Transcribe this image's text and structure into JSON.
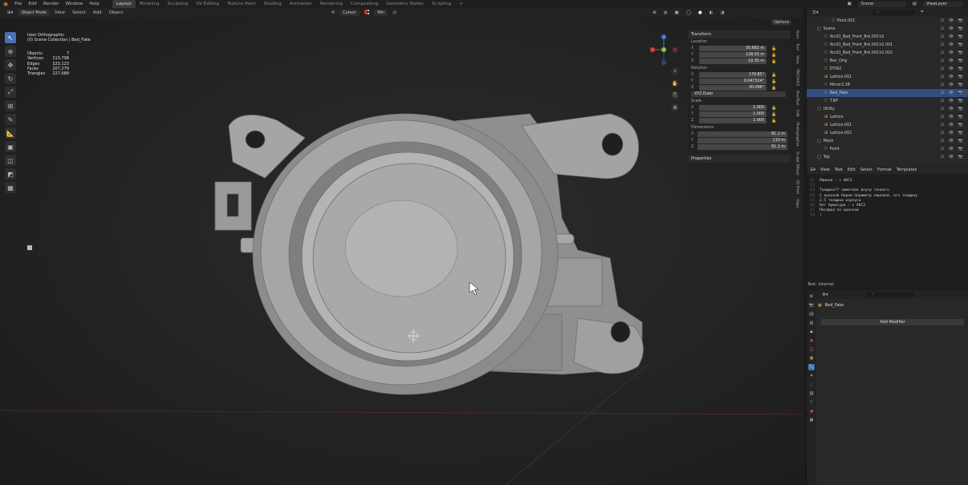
{
  "menu": {
    "items": [
      "File",
      "Edit",
      "Render",
      "Window",
      "Help"
    ],
    "workspaces": [
      "Layout",
      "Modeling",
      "Sculpting",
      "UV Editing",
      "Texture Paint",
      "Shading",
      "Animation",
      "Rendering",
      "Compositing",
      "Geometry Nodes",
      "Scripting",
      "+"
    ],
    "active_workspace": "Layout",
    "scene": "Scene",
    "view_layer": "ViewLayer"
  },
  "viewport_header": {
    "mode": "Object Mode",
    "menus": [
      "View",
      "Select",
      "Add",
      "Object"
    ],
    "pivot": "Cursor",
    "snap": "Min"
  },
  "viewport": {
    "view_name": "User Orthographic",
    "collection": "(0) Scene Collection | Bed_Fake",
    "stats": [
      {
        "label": "Objects",
        "value": "7"
      },
      {
        "label": "Vertices",
        "value": "113,798"
      },
      {
        "label": "Edges",
        "value": "323,123"
      },
      {
        "label": "Faces",
        "value": "207,279"
      },
      {
        "label": "Triangles",
        "value": "227,688"
      }
    ],
    "options_label": "Options"
  },
  "npanel": {
    "transform_title": "Transform",
    "location_label": "Location",
    "location": [
      {
        "axis": "X",
        "value": "30.682 m"
      },
      {
        "axis": "Y",
        "value": "128.03 m"
      },
      {
        "axis": "Z",
        "value": "19.35 m"
      }
    ],
    "rotation_label": "Rotation",
    "rotation": [
      {
        "axis": "X",
        "value": "179.85°"
      },
      {
        "axis": "Y",
        "value": "0.047324°"
      },
      {
        "axis": "Z",
        "value": "30.096°"
      }
    ],
    "rotation_mode": "XYZ Euler",
    "scale_label": "Scale",
    "scale": [
      {
        "axis": "X",
        "value": "1.000"
      },
      {
        "axis": "Y",
        "value": "1.000"
      },
      {
        "axis": "Z",
        "value": "1.000"
      }
    ],
    "dimensions_label": "Dimensions",
    "dimensions": [
      {
        "axis": "X",
        "value": "81.1 m"
      },
      {
        "axis": "Y",
        "value": "110 m"
      },
      {
        "axis": "Z",
        "value": "81.1 m"
      }
    ],
    "properties_title": "Properties",
    "side_tabs": [
      "Item",
      "Tool",
      "View",
      "MACHIN3",
      "BoolTool",
      "Edit",
      "Photographer",
      "Sculpt Wheel",
      "3D Print",
      "Hops"
    ]
  },
  "outliner": {
    "search_placeholder": "",
    "rows": [
      {
        "name": "Point.001",
        "indent": 3,
        "icon": "mesh",
        "selected": false
      },
      {
        "name": "Scene",
        "indent": 1,
        "icon": "collection",
        "selected": false
      },
      {
        "name": "Arc01_Bed_Front_Brk.001V2",
        "indent": 2,
        "icon": "mesh",
        "selected": false
      },
      {
        "name": "Arc01_Bed_Front_Brk.001V2.001",
        "indent": 2,
        "icon": "mesh",
        "selected": false
      },
      {
        "name": "Arc01_Bed_Front_Brk.001V2.002",
        "indent": 2,
        "icon": "mesh",
        "selected": false
      },
      {
        "name": "Box_Orig",
        "indent": 2,
        "icon": "mesh",
        "selected": false
      },
      {
        "name": "DTW2",
        "indent": 2,
        "icon": "mesh",
        "selected": false
      },
      {
        "name": "Lattice.001",
        "indent": 2,
        "icon": "lattice",
        "selected": false
      },
      {
        "name": "Mirror3.2B",
        "indent": 2,
        "icon": "mesh",
        "selected": false
      },
      {
        "name": "Bed_Fake",
        "indent": 2,
        "icon": "mesh",
        "selected": true
      },
      {
        "name": "T.NF",
        "indent": 2,
        "icon": "mesh",
        "selected": false
      },
      {
        "name": "Utility",
        "indent": 1,
        "icon": "collection",
        "selected": false
      },
      {
        "name": "Lattice",
        "indent": 2,
        "icon": "lattice",
        "selected": false
      },
      {
        "name": "Lattice.001",
        "indent": 2,
        "icon": "lattice",
        "selected": false
      },
      {
        "name": "Lattice.002",
        "indent": 2,
        "icon": "lattice",
        "selected": false
      },
      {
        "name": "Mesh",
        "indent": 1,
        "icon": "collection",
        "selected": false
      },
      {
        "name": "Point",
        "indent": 2,
        "icon": "mesh",
        "selected": false
      },
      {
        "name": "Top",
        "indent": 1,
        "icon": "collection",
        "selected": false
      }
    ]
  },
  "text_editor": {
    "menus": [
      "View",
      "Text",
      "Edit",
      "Select",
      "Format",
      "Templates"
    ],
    "line_numbers": [
      "11",
      "12",
      "13",
      "14",
      "15",
      "16",
      "17",
      "18"
    ],
    "lines": [
      "Ламели : с АКС3",
      "",
      "Толщина?? заметная внутр тонкого",
      "С краской берем периметр лицевой. его толщину",
      "2.5 толщина корпуса",
      "Нет  Арматура : с АКС3",
      "Посадка по краской",
      ""
    ],
    "status": "Text: Internal"
  },
  "properties": {
    "object_name": "Bed_Fake",
    "add_modifier": "Add Modifier"
  },
  "colors": {
    "accent": "#4772b3",
    "selection": "#334d80",
    "mesh": "#9a9a9a"
  }
}
